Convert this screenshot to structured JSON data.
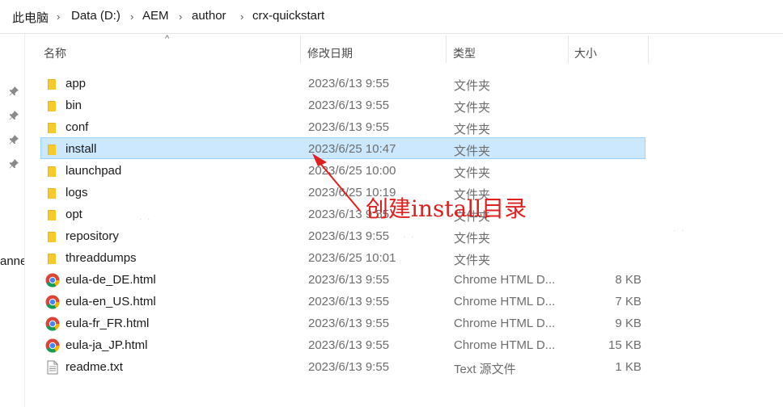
{
  "breadcrumb": {
    "items": [
      "此电脑",
      "Data (D:)",
      "AEM",
      "author",
      "crx-quickstart"
    ],
    "separator": "›"
  },
  "navpane": {
    "truncated_label": "anne"
  },
  "columns": {
    "name": "名称",
    "date": "修改日期",
    "type": "类型",
    "size": "大小"
  },
  "files": [
    {
      "name": "app",
      "date": "2023/6/13 9:55",
      "type": "文件夹",
      "size": "",
      "icon": "folder-icon",
      "selected": false
    },
    {
      "name": "bin",
      "date": "2023/6/13 9:55",
      "type": "文件夹",
      "size": "",
      "icon": "folder-icon",
      "selected": false
    },
    {
      "name": "conf",
      "date": "2023/6/13 9:55",
      "type": "文件夹",
      "size": "",
      "icon": "folder-icon",
      "selected": false
    },
    {
      "name": "install",
      "date": "2023/6/25 10:47",
      "type": "文件夹",
      "size": "",
      "icon": "folder-icon",
      "selected": true
    },
    {
      "name": "launchpad",
      "date": "2023/6/25 10:00",
      "type": "文件夹",
      "size": "",
      "icon": "folder-icon",
      "selected": false
    },
    {
      "name": "logs",
      "date": "2023/6/25 10:19",
      "type": "文件夹",
      "size": "",
      "icon": "folder-icon",
      "selected": false
    },
    {
      "name": "opt",
      "date": "2023/6/13 9:55",
      "type": "文件夹",
      "size": "",
      "icon": "folder-icon",
      "selected": false
    },
    {
      "name": "repository",
      "date": "2023/6/13 9:55",
      "type": "文件夹",
      "size": "",
      "icon": "folder-icon",
      "selected": false
    },
    {
      "name": "threaddumps",
      "date": "2023/6/25 10:01",
      "type": "文件夹",
      "size": "",
      "icon": "folder-icon",
      "selected": false
    },
    {
      "name": "eula-de_DE.html",
      "date": "2023/6/13 9:55",
      "type": "Chrome HTML D...",
      "size": "8 KB",
      "icon": "chrome-icon",
      "selected": false
    },
    {
      "name": "eula-en_US.html",
      "date": "2023/6/13 9:55",
      "type": "Chrome HTML D...",
      "size": "7 KB",
      "icon": "chrome-icon",
      "selected": false
    },
    {
      "name": "eula-fr_FR.html",
      "date": "2023/6/13 9:55",
      "type": "Chrome HTML D...",
      "size": "9 KB",
      "icon": "chrome-icon",
      "selected": false
    },
    {
      "name": "eula-ja_JP.html",
      "date": "2023/6/13 9:55",
      "type": "Chrome HTML D...",
      "size": "15 KB",
      "icon": "chrome-icon",
      "selected": false
    },
    {
      "name": "readme.txt",
      "date": "2023/6/13 9:55",
      "type": "Text 源文件",
      "size": "1 KB",
      "icon": "text-file-icon",
      "selected": false
    }
  ],
  "annotation": {
    "text": "创建install目录",
    "color": "#e0201f"
  },
  "colors": {
    "selection_bg": "#cce8ff",
    "selection_border": "#99d1ff",
    "folder": "#f8c92b"
  }
}
